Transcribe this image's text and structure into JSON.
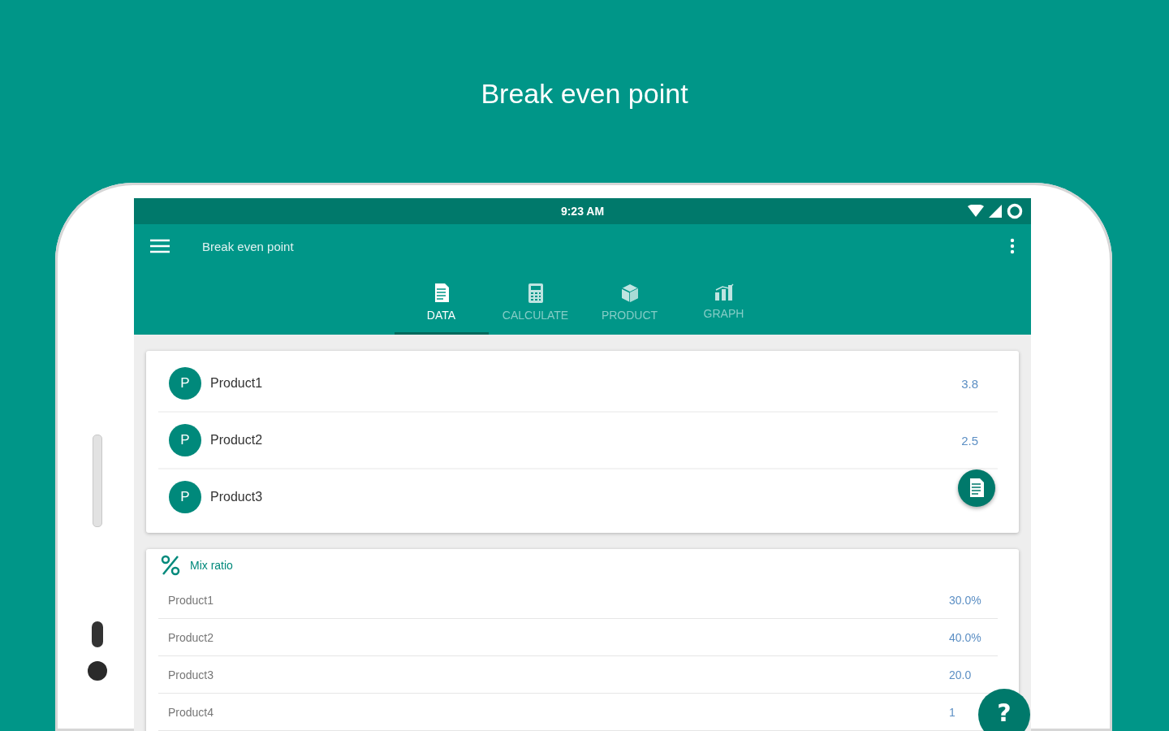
{
  "headline": "Break even point",
  "status_bar": {
    "time": "9:23 AM"
  },
  "app_bar": {
    "title": "Break even point"
  },
  "tabs": [
    {
      "kind": "data",
      "label": "DATA",
      "selected": true
    },
    {
      "kind": "calculate",
      "label": "CALCULATE",
      "selected": false
    },
    {
      "kind": "product",
      "label": "PRODUCT",
      "selected": false
    },
    {
      "kind": "graph",
      "label": "GRAPH",
      "selected": false
    }
  ],
  "products": [
    {
      "avatar": "P",
      "name": "Product1",
      "value": "3.8"
    },
    {
      "avatar": "P",
      "name": "Product2",
      "value": "2.5"
    },
    {
      "avatar": "P",
      "name": "Product3"
    }
  ],
  "mix_ratio": {
    "title": "Mix ratio",
    "rows": [
      {
        "name": "Product1",
        "value": "30.0%"
      },
      {
        "name": "Product2",
        "value": "40.0%"
      },
      {
        "name": "Product3",
        "value": "20.0"
      },
      {
        "name": "Product4",
        "value": "1"
      }
    ]
  },
  "help_button": {
    "label": "?"
  }
}
